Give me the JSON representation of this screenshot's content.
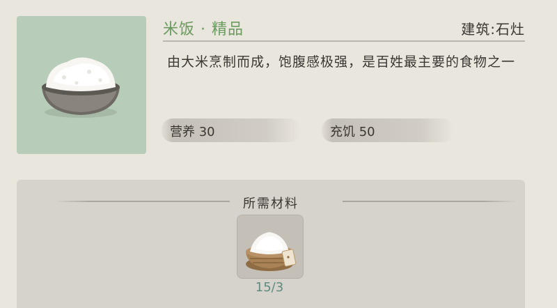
{
  "item": {
    "name": "米饭",
    "quality": "精品",
    "title": "米饭 · 精品",
    "building": "建筑:石灶",
    "description": "由大米烹制而成，饱腹感极强，是百姓最主要的食物之一",
    "icon": "rice-bowl-icon"
  },
  "stats": {
    "nutrition": "营养 30",
    "satiety": "充饥 50"
  },
  "materials": {
    "title": "所需材料",
    "items": [
      {
        "icon": "rice-basket-icon",
        "count": "15/3"
      }
    ]
  },
  "colors": {
    "background": "#e9e6de",
    "icon_frame": "#b8cdb9",
    "title_green": "#6a9a5e",
    "count_teal": "#5f8a80",
    "panel": "#d6d3cc"
  }
}
